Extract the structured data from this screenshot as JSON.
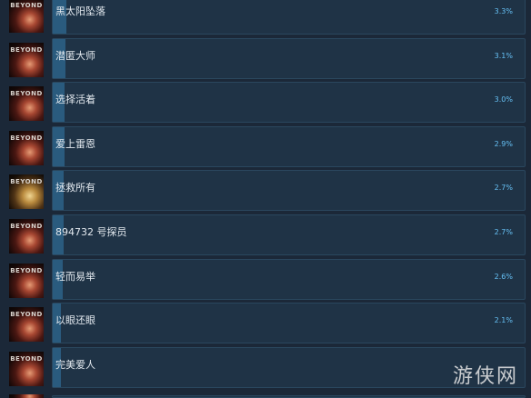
{
  "icon_text": "BEYOND",
  "colors": {
    "background": "#1b2838",
    "bar_fill": "#2a5b7e",
    "percent_text": "#66c0f4",
    "title_text": "#e2e8ee"
  },
  "achievements": [
    {
      "name": "黑太阳坠落",
      "percent": "3.3%",
      "fill": 3.3,
      "icon": "beyond-icon"
    },
    {
      "name": "潜匿大师",
      "percent": "3.1%",
      "fill": 3.1,
      "icon": "beyond-icon"
    },
    {
      "name": "选择活着",
      "percent": "3.0%",
      "fill": 3.0,
      "icon": "beyond-icon"
    },
    {
      "name": "爱上雷恩",
      "percent": "2.9%",
      "fill": 2.9,
      "icon": "beyond-icon"
    },
    {
      "name": "拯救所有",
      "percent": "2.7%",
      "fill": 2.7,
      "icon": "beyond-icon-gold"
    },
    {
      "name": "894732 号探员",
      "percent": "2.7%",
      "fill": 2.7,
      "icon": "beyond-icon"
    },
    {
      "name": "轻而易举",
      "percent": "2.6%",
      "fill": 2.6,
      "icon": "beyond-icon"
    },
    {
      "name": "以眼还眼",
      "percent": "2.1%",
      "fill": 2.1,
      "icon": "beyond-icon"
    },
    {
      "name": "完美爱人",
      "percent": "",
      "fill": 2.0,
      "icon": "beyond-icon"
    }
  ],
  "watermark": "游侠网"
}
